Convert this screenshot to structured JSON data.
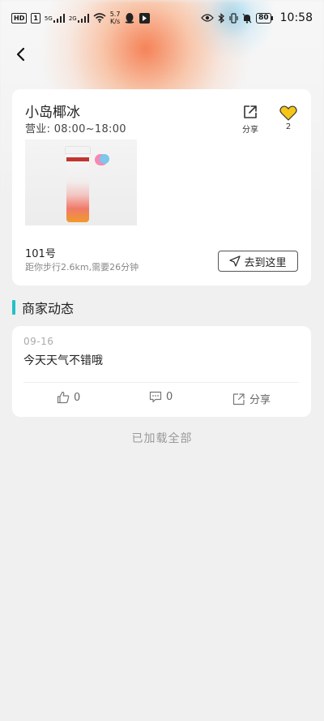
{
  "status_bar": {
    "left_badge_1": "HD",
    "left_badge_2": "1",
    "network_1": "5G",
    "network_2": "2G",
    "speed_value": "5.7",
    "speed_unit": "K/s",
    "battery": "80",
    "time": "10:58"
  },
  "store": {
    "name": "小岛椰冰",
    "hours": "营业: 08:00~18:00",
    "share_label": "分享",
    "fav_count": "2",
    "address_number": "101号",
    "distance_text": "距你步行2.6km,需要26分钟",
    "go_button_label": "去到这里"
  },
  "section": {
    "title": "商家动态"
  },
  "posts": [
    {
      "date": "09-16",
      "text": "今天天气不错哦",
      "likes": "0",
      "comments": "0",
      "share_label": "分享"
    }
  ],
  "footer": {
    "loaded_all": "已加载全部"
  },
  "colors": {
    "accent_teal": "#26c0c6",
    "heart_yellow": "#f5c518",
    "page_bg": "#f0f0f0"
  },
  "icons": {
    "back": "chevron-left-icon",
    "share": "share-out-icon",
    "favorite": "heart-icon",
    "navigate": "navigation-arrow-icon",
    "like": "thumbs-up-icon",
    "comment": "comment-icon"
  }
}
